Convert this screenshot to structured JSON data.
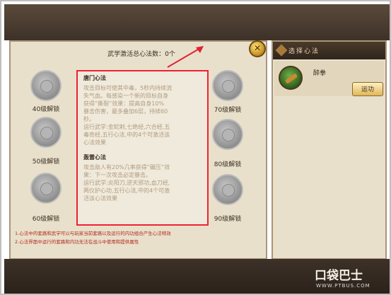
{
  "panel": {
    "title": "武学激活总心法数：0个"
  },
  "slots": [
    {
      "label": "40级解锁"
    },
    {
      "label": "50级解锁"
    },
    {
      "label": "60级解锁"
    },
    {
      "label": "70级解锁"
    },
    {
      "label": "80级解锁"
    },
    {
      "label": "90级解锁"
    }
  ],
  "info": {
    "section1_title": "唐门心法",
    "section1_lines": [
      "攻击目标可使其中毒，5秒内持续流",
      "失气血。每感染一个新的目标自身",
      "获得“撕裂”效果：提高自身10%",
      "暴击伤害，最多叠加6层，持续60",
      "秒。",
      "运行武学:金蛇剌,七绝经,六合经,五",
      "毒奇经,五行心法,中的4个可激活该",
      "心法效果"
    ],
    "section2_title": "轰雷心法",
    "section2_lines": [
      "攻击敌人有20%几率获得“碾压”效",
      "果：下一次攻击必定暴击。",
      "运行武学:炎阳刀,逆天邪功,血刀经,",
      "两仪护心功,五行心法,中的4个可激",
      "活该心法效果"
    ]
  },
  "notes": [
    "1.心法中的套路和武学可以与玩家当前套路以及运行的内功组合产生心法特效",
    "2.心法界面中运行的套路和内功无法在战斗中使用和提供属性"
  ],
  "close": {
    "glyph": "✕"
  },
  "right_panel": {
    "header": "选择心法",
    "skill_name": "醉拳",
    "action_label": "运功"
  },
  "watermark": {
    "brand": "口袋巴士",
    "url": "WWW.PTBUS.COM"
  },
  "colors": {
    "highlight_border": "#e22233",
    "note_text": "#b12c1c"
  }
}
